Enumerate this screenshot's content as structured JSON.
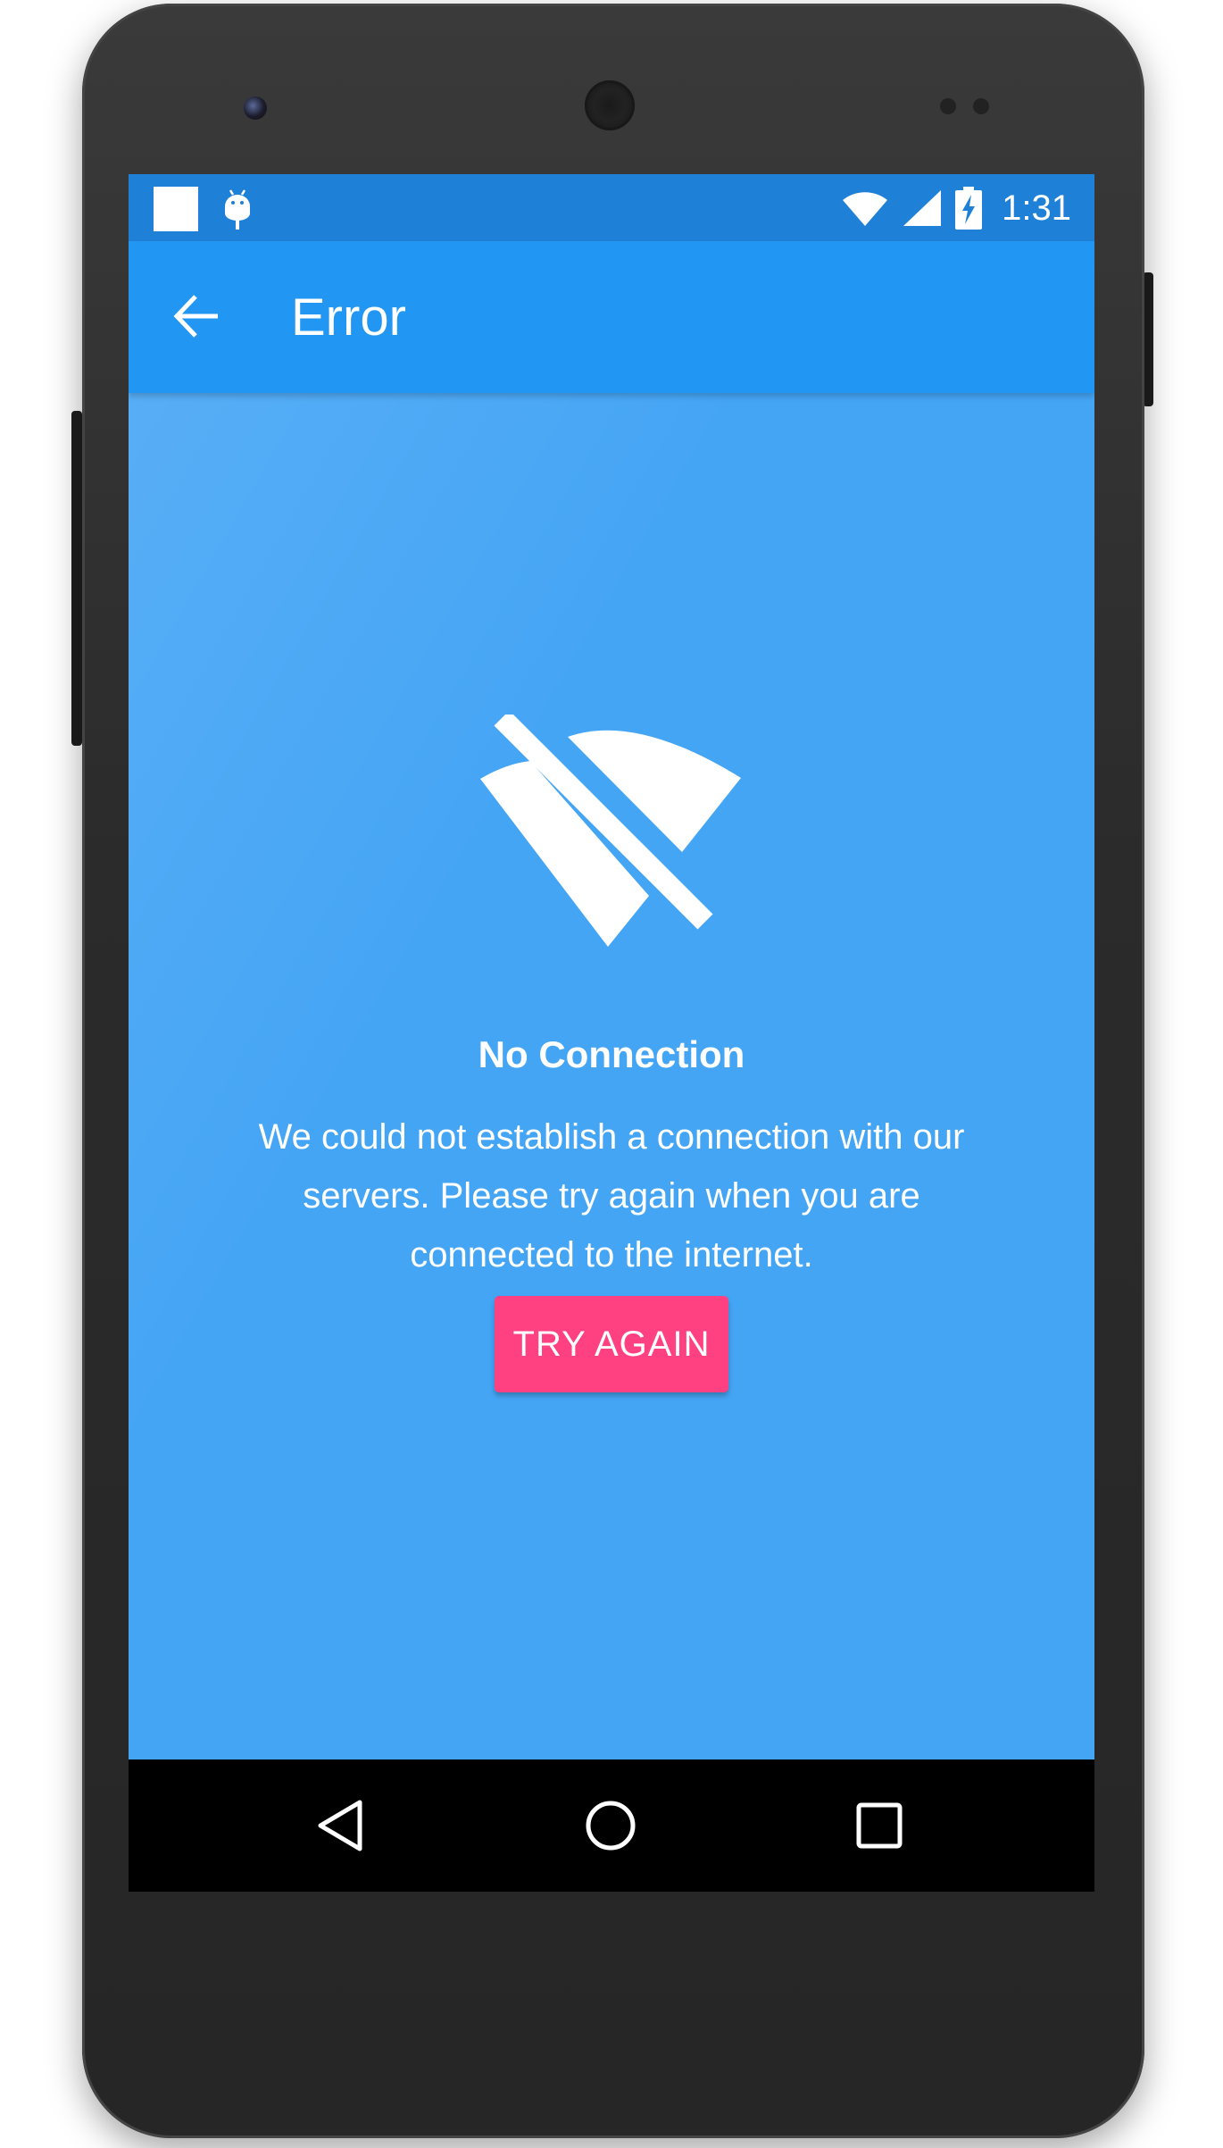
{
  "status_bar": {
    "time": "1:31",
    "icons": [
      "notification-square-icon",
      "android-debug-icon",
      "wifi-icon",
      "cellular-signal-icon",
      "battery-charging-icon"
    ]
  },
  "app_bar": {
    "title": "Error",
    "back_icon": "arrow-back-icon"
  },
  "error": {
    "icon": "wifi-off-icon",
    "title": "No Connection",
    "message": "We could not establish a connection with our servers. Please try again when you are connected to the internet.",
    "button_label": "TRY AGAIN"
  },
  "nav_bar": {
    "buttons": [
      "back-triangle-icon",
      "home-circle-icon",
      "recents-square-icon"
    ]
  },
  "colors": {
    "status_bar": "#1f80d8",
    "app_bar": "#2196f3",
    "content_bg": "#45a5f5",
    "accent": "#ff4081"
  }
}
